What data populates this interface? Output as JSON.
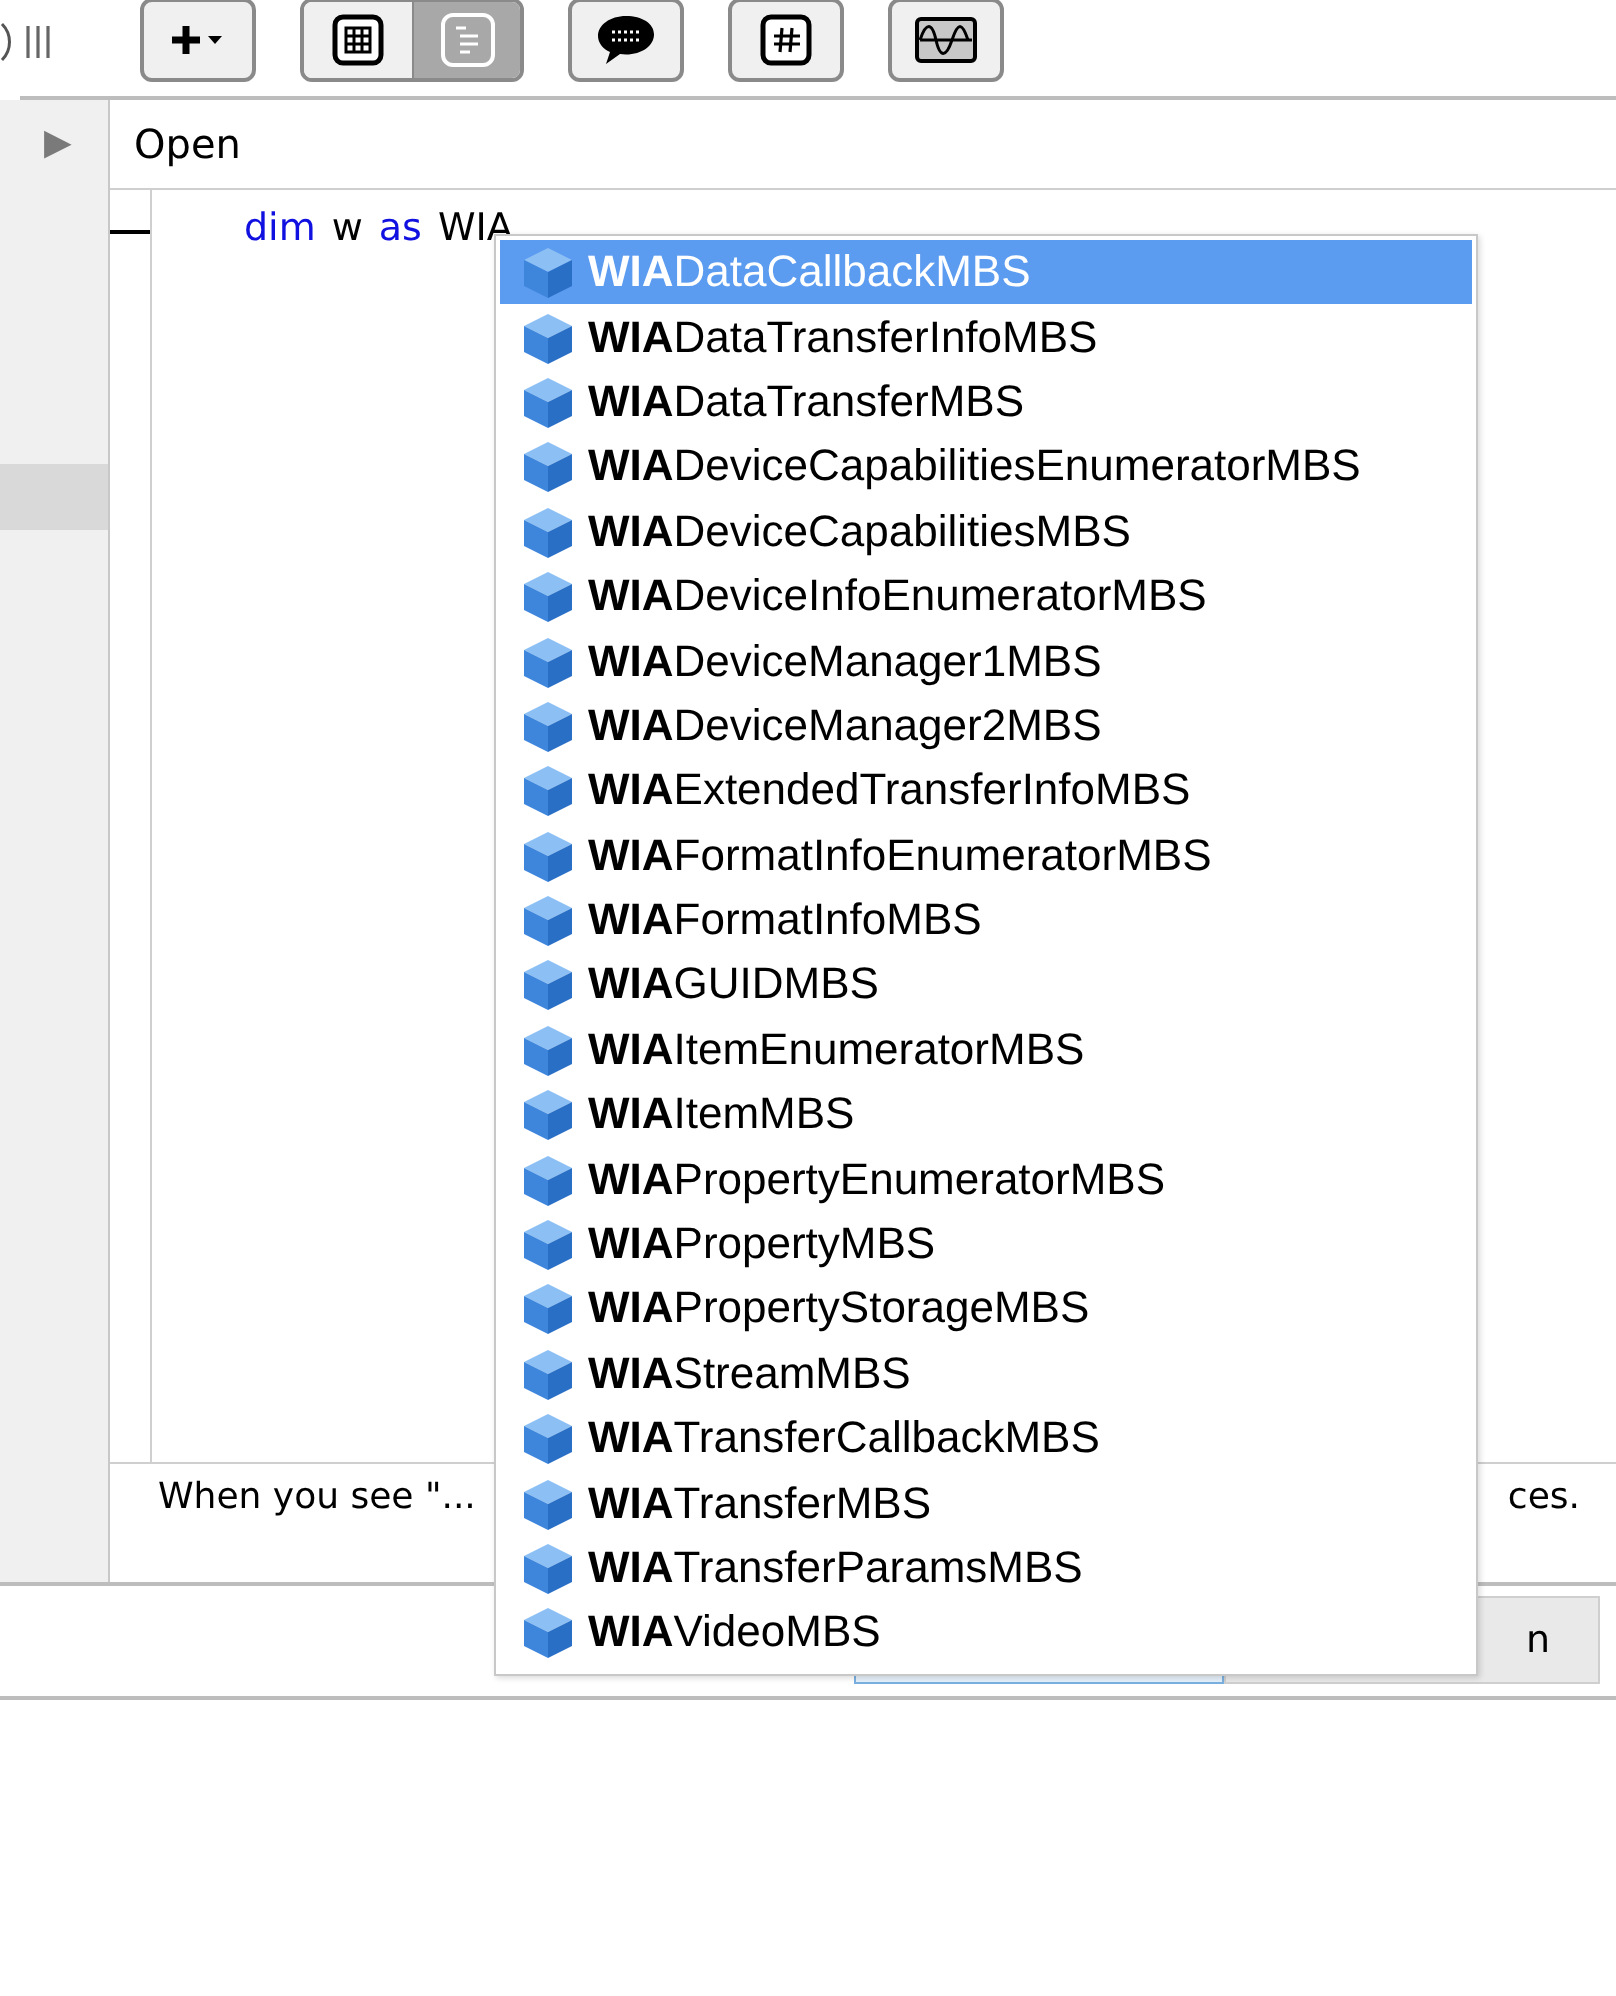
{
  "toolbar": {
    "buttons": [
      {
        "kind": "add",
        "selected": false
      },
      {
        "kind": "segmented",
        "buttons": [
          {
            "kind": "grid",
            "selected": false
          },
          {
            "kind": "document",
            "selected": true
          }
        ]
      },
      {
        "kind": "speech",
        "selected": false
      },
      {
        "kind": "hash",
        "selected": false
      },
      {
        "kind": "wave",
        "selected": false
      }
    ]
  },
  "sidebar": {
    "arrow": "▶"
  },
  "editor": {
    "header": "Open",
    "code_line": [
      {
        "text": "dim",
        "kind": "keyword"
      },
      {
        "text": "w",
        "kind": "plain"
      },
      {
        "text": "as",
        "kind": "keyword"
      },
      {
        "text": "WIA",
        "kind": "plain"
      }
    ]
  },
  "help_text": {
    "start": "When you see \"...",
    "end": "ces."
  },
  "bottom_buttons": [
    {
      "kind": "default"
    },
    {
      "label": "n",
      "kind": "plain"
    }
  ],
  "autocomplete": [
    {
      "label": "**WIA**DataCallbackMBS",
      "selected": true
    },
    {
      "label": "**WIA**DataTransferInfoMBS",
      "selected": false
    },
    {
      "label": "**WIA**DataTransferMBS",
      "selected": false
    },
    {
      "label": "**WIA**DeviceCapabilitiesEnumeratorMBS",
      "selected": false
    },
    {
      "label": "**WIA**DeviceCapabilitiesMBS",
      "selected": false
    },
    {
      "label": "**WIA**DeviceInfoEnumeratorMBS",
      "selected": false
    },
    {
      "label": "**WIA**DeviceManager1MBS",
      "selected": false
    },
    {
      "label": "**WIA**DeviceManager2MBS",
      "selected": false
    },
    {
      "label": "**WIA**ExtendedTransferInfoMBS",
      "selected": false
    },
    {
      "label": "**WIA**FormatInfoEnumeratorMBS",
      "selected": false
    },
    {
      "label": "**WIA**FormatInfoMBS",
      "selected": false
    },
    {
      "label": "**WIA**GUIDMBS",
      "selected": false
    },
    {
      "label": "**WIA**ItemEnumeratorMBS",
      "selected": false
    },
    {
      "label": "**WIA**ItemMBS",
      "selected": false
    },
    {
      "label": "**WIA**PropertyEnumeratorMBS",
      "selected": false
    },
    {
      "label": "**WIA**PropertyMBS",
      "selected": false
    },
    {
      "label": "**WIA**PropertyStorageMBS",
      "selected": false
    },
    {
      "label": "**WIA**StreamMBS",
      "selected": false
    },
    {
      "label": "**WIA**TransferCallbackMBS",
      "selected": false
    },
    {
      "label": "**WIA**TransferMBS",
      "selected": false
    },
    {
      "label": "**WIA**TransferParamsMBS",
      "selected": false
    },
    {
      "label": "**WIA**VideoMBS",
      "selected": false
    }
  ]
}
